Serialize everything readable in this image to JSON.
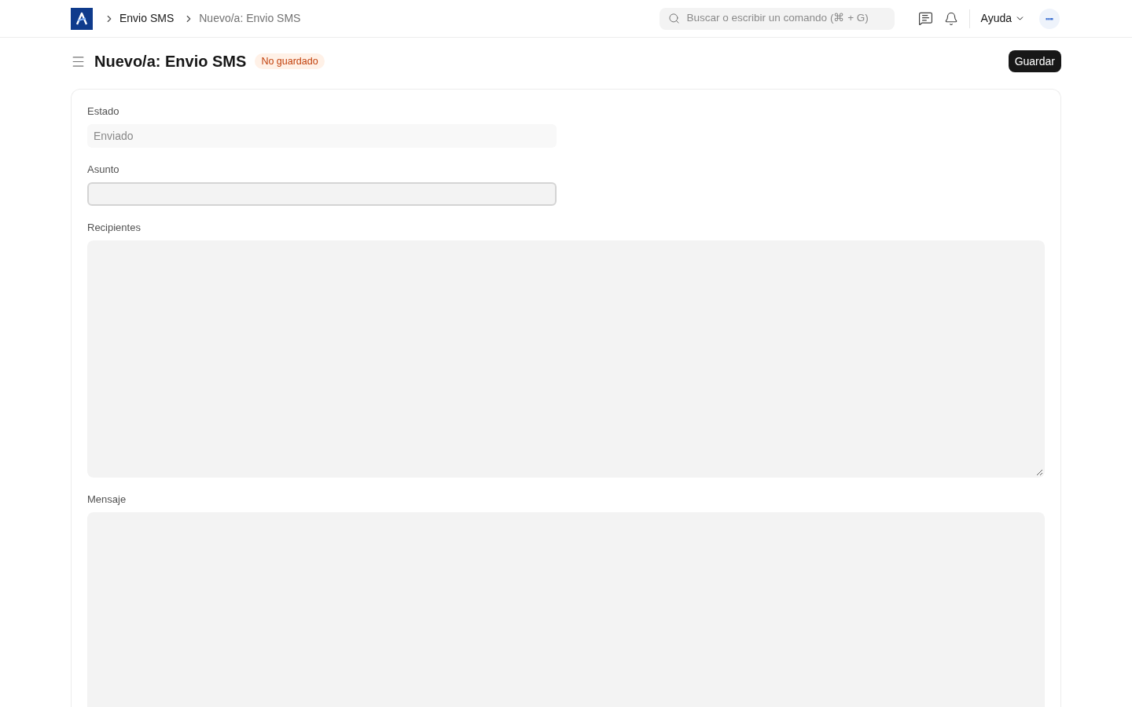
{
  "navbar": {
    "breadcrumbs": [
      {
        "label": "Envio SMS",
        "current": false
      },
      {
        "label": "Nuevo/a: Envio SMS",
        "current": true
      }
    ],
    "search": {
      "placeholder": "Buscar o escribir un comando (⌘ + G)"
    },
    "help_menu": {
      "label": "Ayuda"
    }
  },
  "page_header": {
    "title": "Nuevo/a: Envio SMS",
    "status_badge": "No guardado",
    "primary_button": "Guardar"
  },
  "form": {
    "fields": [
      {
        "kind": "read_only",
        "label": "Estado",
        "value": "Enviado",
        "focused": false
      },
      {
        "kind": "input",
        "label": "Asunto",
        "focused": true
      },
      {
        "kind": "textarea",
        "label": "Recipientes",
        "focused": false
      },
      {
        "kind": "textarea",
        "label": "Mensaje",
        "focused": false
      }
    ]
  }
}
